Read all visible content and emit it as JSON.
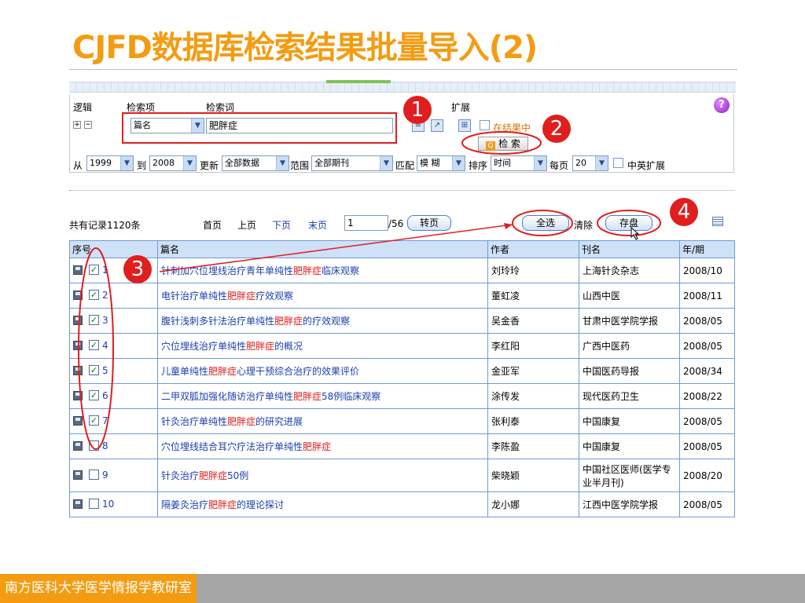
{
  "slide": {
    "title": "CJFD数据库检索结果批量导入(2)",
    "footer": "南方医科大学医学情报学教研室"
  },
  "search_form": {
    "col_logic": "逻辑",
    "col_field": "检索项",
    "col_term": "检索词",
    "col_expand": "扩展",
    "field_value": "篇名",
    "term_value": "肥胖症",
    "in_results_label": "在结果中",
    "search_button": "检 索",
    "from_label": "从",
    "year_from": "1999",
    "to_label": "到",
    "year_to": "2008",
    "update_label": "更新",
    "update_value": "全部数据",
    "range_label": "范围",
    "range_value": "全部期刊",
    "match_label": "匹配",
    "match_value": "模 糊",
    "sort_label": "排序",
    "sort_value": "时间",
    "per_page_label": "每页",
    "per_page_value": "20",
    "cn_en_label": "中英扩展"
  },
  "pager": {
    "total": "共有记录1120条",
    "first": "首页",
    "prev": "上页",
    "next": "下页",
    "last": "末页",
    "page_value": "1",
    "page_total": "/56",
    "goto": "转页",
    "select_all": "全选",
    "clear": "清除",
    "save": "存盘"
  },
  "table": {
    "headers": [
      "序号",
      "篇名",
      "作者",
      "刊名",
      "年/期"
    ],
    "rows": [
      {
        "no": "1",
        "checked": true,
        "pre": "针刺加穴位埋线治疗青年单纯性",
        "hl": "肥胖症",
        "post": "临床观察",
        "author": "刘玲玲",
        "journal": "上海针灸杂志",
        "issue": "2008/10"
      },
      {
        "no": "2",
        "checked": true,
        "pre": "电针治疗单纯性",
        "hl": "肥胖症",
        "post": "疗效观察",
        "author": "董虹凌",
        "journal": "山西中医",
        "issue": "2008/11"
      },
      {
        "no": "3",
        "checked": true,
        "pre": "腹针浅刺多针法治疗单纯性",
        "hl": "肥胖症",
        "post": "的疗效观察",
        "author": "吴金香",
        "journal": "甘肃中医学院学报",
        "issue": "2008/05"
      },
      {
        "no": "4",
        "checked": true,
        "pre": "穴位埋线治疗单纯性",
        "hl": "肥胖症",
        "post": "的概况",
        "author": "李红阳",
        "journal": "广西中医药",
        "issue": "2008/05"
      },
      {
        "no": "5",
        "checked": true,
        "pre": "儿童单纯性",
        "hl": "肥胖症",
        "post": "心理干预综合治疗的效果评价",
        "author": "金亚军",
        "journal": "中国医药导报",
        "issue": "2008/34"
      },
      {
        "no": "6",
        "checked": true,
        "pre": "二甲双胍加强化随访治疗单纯性",
        "hl": "肥胖症",
        "post": "58例临床观察",
        "author": "涂传发",
        "journal": "现代医药卫生",
        "issue": "2008/22"
      },
      {
        "no": "7",
        "checked": true,
        "pre": "针灸治疗单纯性",
        "hl": "肥胖症",
        "post": "的研究进展",
        "author": "张利泰",
        "journal": "中国康复",
        "issue": "2008/05"
      },
      {
        "no": "8",
        "checked": false,
        "pre": "穴位埋线结合耳穴疗法治疗单纯性",
        "hl": "肥胖症",
        "post": "",
        "author": "李陈盈",
        "journal": "中国康复",
        "issue": "2008/05"
      },
      {
        "no": "9",
        "checked": false,
        "pre": "针灸治疗",
        "hl": "肥胖症",
        "post": "50例",
        "author": "柴晓颖",
        "journal": "中国社区医师(医学专业半月刊)",
        "issue": "2008/20"
      },
      {
        "no": "10",
        "checked": false,
        "pre": "隔姜灸治疗",
        "hl": "肥胖症",
        "post": "的理论探讨",
        "author": "龙小娜",
        "journal": "江西中医学院学报",
        "issue": "2008/05"
      }
    ]
  },
  "annotations": {
    "n1": "1",
    "n2": "2",
    "n3": "3",
    "n4": "4",
    "color": "#e01e1e"
  },
  "colors": {
    "title": "#f39c12",
    "header_bg": "#cfe1f7",
    "highlight": "#e21b1b",
    "link": "#1a3fb0",
    "footer_accent": "#f39c12",
    "footer_bar": "#a6a6a6"
  }
}
